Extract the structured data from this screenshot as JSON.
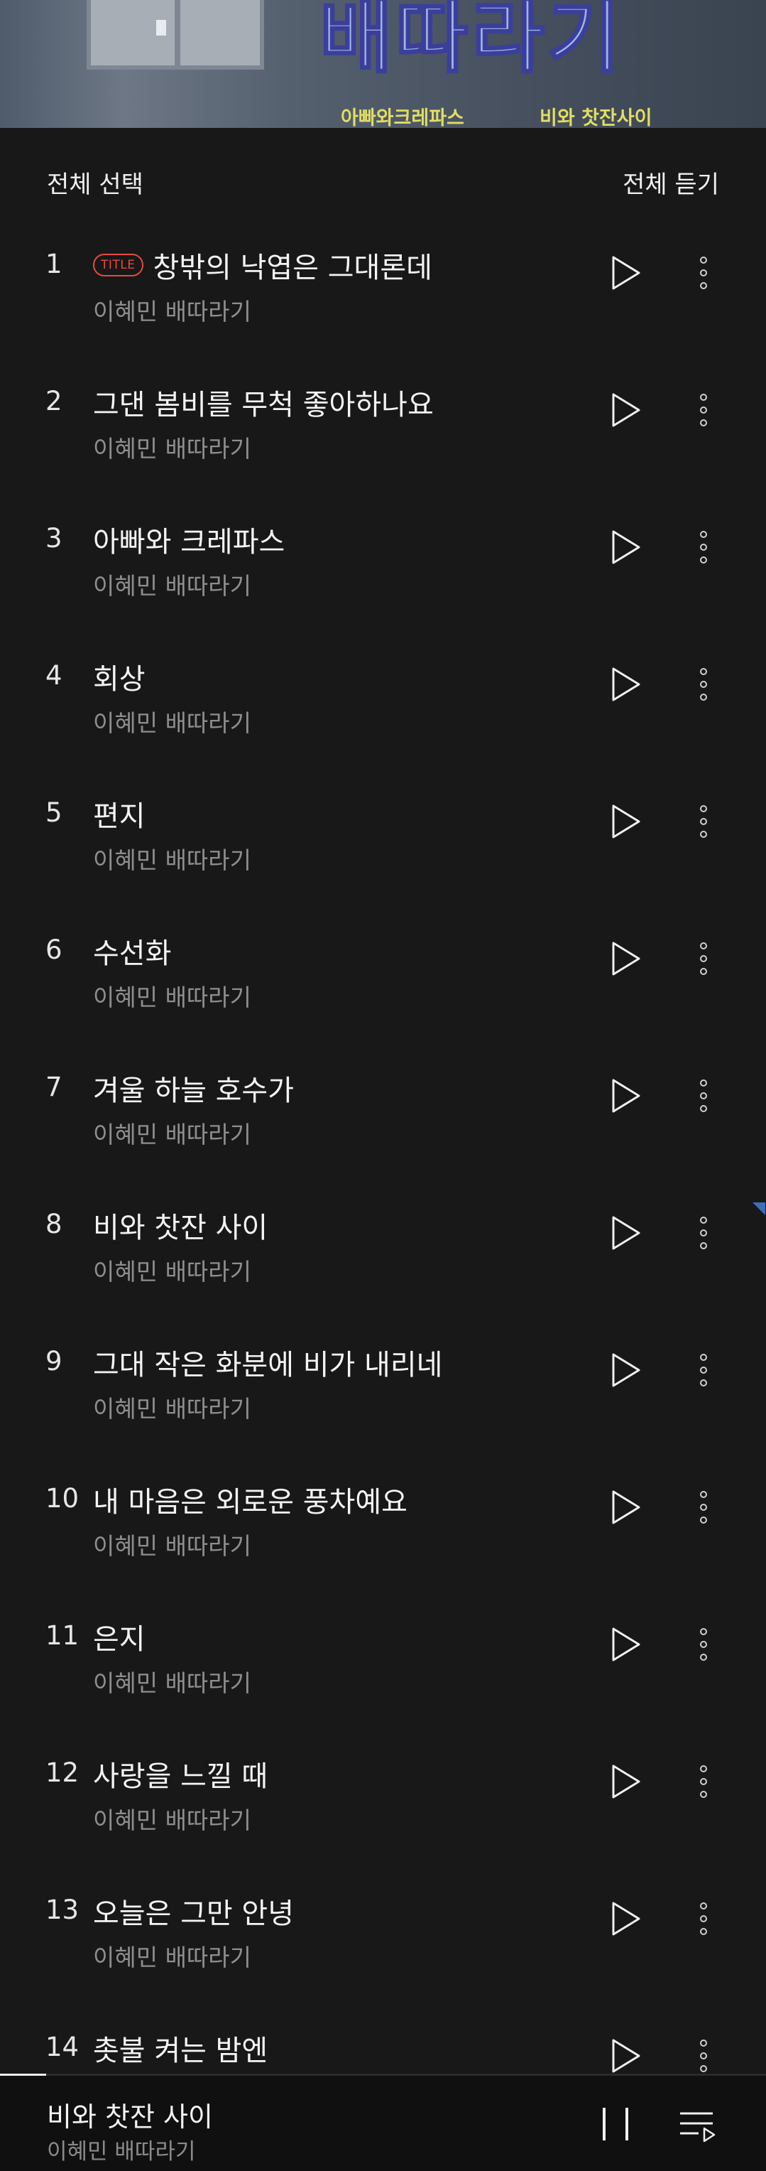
{
  "album_art": {
    "title_text": "배따라기",
    "subtitle_left": "아빠와크레파스",
    "subtitle_right": "비와 찻잔사이"
  },
  "header": {
    "select_all_label": "전체 선택",
    "play_all_label": "전체 듣기"
  },
  "title_badge": "TITLE",
  "tracks": [
    {
      "number": "1",
      "title": "창밖의 낙엽은 그대론데",
      "artist": "이혜민 배따라기",
      "is_title_track": true
    },
    {
      "number": "2",
      "title": "그댄 봄비를 무척 좋아하나요",
      "artist": "이혜민 배따라기"
    },
    {
      "number": "3",
      "title": "아빠와 크레파스",
      "artist": "이혜민 배따라기"
    },
    {
      "number": "4",
      "title": "회상",
      "artist": "이혜민 배따라기"
    },
    {
      "number": "5",
      "title": "편지",
      "artist": "이혜민 배따라기"
    },
    {
      "number": "6",
      "title": "수선화",
      "artist": "이혜민 배따라기"
    },
    {
      "number": "7",
      "title": "겨울 하늘 호수가",
      "artist": "이혜민 배따라기"
    },
    {
      "number": "8",
      "title": "비와 찻잔 사이",
      "artist": "이혜민 배따라기"
    },
    {
      "number": "9",
      "title": "그대 작은 화분에 비가 내리네",
      "artist": "이혜민 배따라기"
    },
    {
      "number": "10",
      "title": "내 마음은 외로운 풍차예요",
      "artist": "이혜민 배따라기"
    },
    {
      "number": "11",
      "title": "은지",
      "artist": "이혜민 배따라기"
    },
    {
      "number": "12",
      "title": "사랑을 느낄 때",
      "artist": "이혜민 배따라기"
    },
    {
      "number": "13",
      "title": "오늘은 그만 안녕",
      "artist": "이혜민 배따라기"
    },
    {
      "number": "14",
      "title": "촛불 켜는 밤엔",
      "artist": "이혜민 배따라기"
    }
  ],
  "now_playing": {
    "title": "비와 찻잔 사이",
    "artist": "이혜민 배따라기",
    "progress_fraction": 0.06
  },
  "icons": {
    "track_play": "play-icon",
    "track_more": "more-vertical-icon",
    "player_pause": "pause-icon",
    "player_queue": "playlist-icon"
  },
  "colors": {
    "background": "#181818",
    "title_badge": "#e64a3c",
    "artist_text": "#8e8e8e",
    "player_background": "#101010"
  }
}
